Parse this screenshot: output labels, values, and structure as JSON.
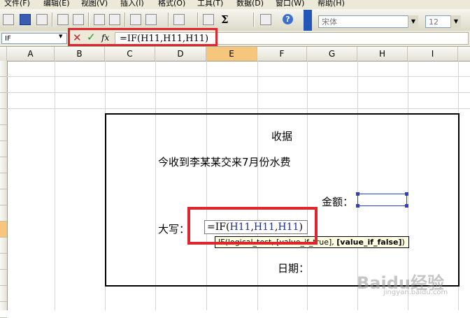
{
  "menu": [
    "文件(F)",
    "编辑(E)",
    "视图(V)",
    "插入(I)",
    "格式(O)",
    "工具(T)",
    "数据(D)",
    "窗口(W)",
    "帮助(H)"
  ],
  "toolbar": {
    "font_name": "宋体",
    "font_size": "12",
    "sigma": "Σ",
    "help": "?"
  },
  "formula_bar": {
    "name_box": "IF",
    "cancel": "✕",
    "enter": "✓",
    "fx": "fx",
    "formula": "=IF(H11,H11,H11)"
  },
  "columns": [
    "A",
    "B",
    "C",
    "D",
    "E",
    "F",
    "G",
    "H",
    "I"
  ],
  "sheet": {
    "title": "收据",
    "line1": "今收到李某某交来7月份水费",
    "amount_label": "金额：",
    "capital_label": "大写：",
    "date_label": "日期：",
    "edit_formula_prefix": "=IF(",
    "edit_formula_ref1": "H11",
    "edit_formula_sep1": ",",
    "edit_formula_ref2": "H11",
    "edit_formula_sep2": ",",
    "edit_formula_ref3": "H11",
    "edit_formula_suffix": ")",
    "tooltip_normal": "IF(logical_test, [value_if_true], ",
    "tooltip_bold": "[value_if_false]",
    "tooltip_end": ")"
  },
  "watermark": {
    "main": "Baidu经验",
    "sub": "jingyan.baidu.com"
  },
  "colors": {
    "highlight": "#e0262d",
    "selected_header": "#f7c67d",
    "cell_ref": "#1a2ea8"
  }
}
